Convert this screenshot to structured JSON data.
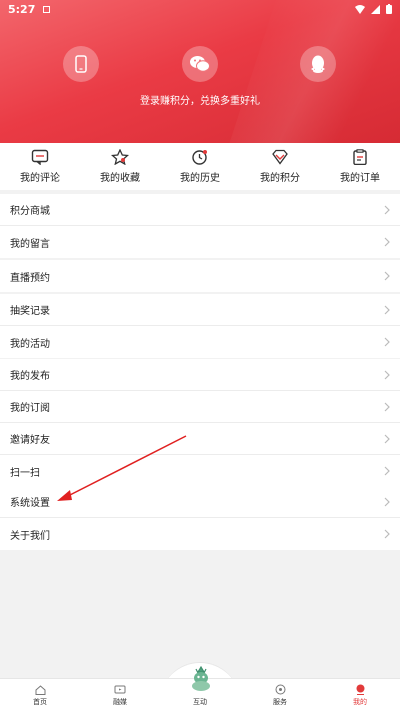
{
  "status": {
    "time": "5:27"
  },
  "header": {
    "login_methods": [
      {
        "icon": "phone-icon"
      },
      {
        "icon": "wechat-icon"
      },
      {
        "icon": "qq-icon"
      }
    ],
    "login_prompt": "登录赚积分，兑换多重好礼",
    "accent": "#e8414a"
  },
  "quick_menu": [
    {
      "label": "我的评论",
      "icon": "comment-icon"
    },
    {
      "label": "我的收藏",
      "icon": "star-icon"
    },
    {
      "label": "我的历史",
      "icon": "clock-icon"
    },
    {
      "label": "我的积分",
      "icon": "diamond-icon"
    },
    {
      "label": "我的订单",
      "icon": "clipboard-icon"
    }
  ],
  "groups": [
    {
      "items": [
        "积分商城",
        "我的留言"
      ]
    },
    {
      "items": [
        "直播预约"
      ]
    },
    {
      "items": [
        "抽奖记录",
        "我的活动"
      ]
    },
    {
      "items": [
        "我的发布",
        "我的订阅",
        "邀请好友",
        "扫一扫"
      ]
    },
    {
      "items": [
        "系统设置",
        "关于我们"
      ]
    }
  ],
  "tabbar": {
    "tabs": [
      {
        "label": "首页",
        "icon": "home-icon"
      },
      {
        "label": "融媒",
        "icon": "tv-icon"
      },
      {
        "label": "互动",
        "icon": "mascot-icon"
      },
      {
        "label": "服务",
        "icon": "service-icon"
      },
      {
        "label": "我的",
        "icon": "profile-icon"
      }
    ],
    "active_index": 4,
    "active_color": "#e23a3a"
  }
}
